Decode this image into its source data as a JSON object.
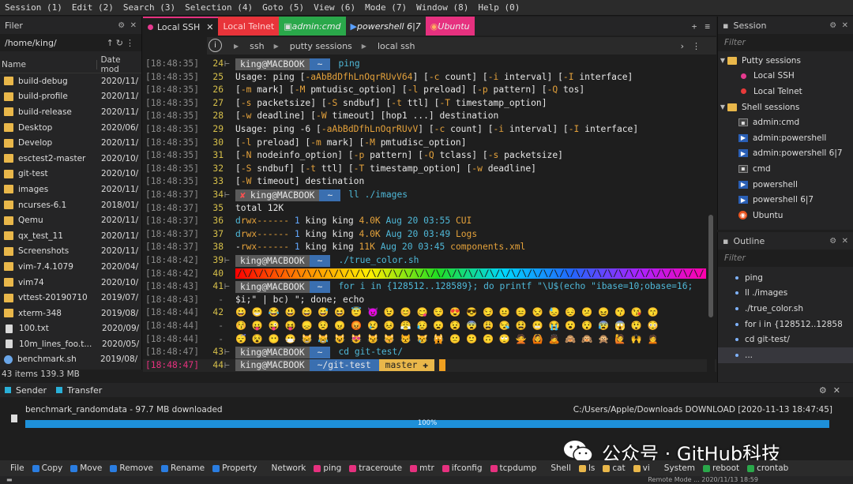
{
  "menu": [
    "Session (1)",
    "Edit (2)",
    "Search (3)",
    "Selection (4)",
    "Goto (5)",
    "View (6)",
    "Mode (7)",
    "Window (8)",
    "Help (0)"
  ],
  "filer": {
    "title": "Filer",
    "path": "/home/king/",
    "col_name": "Name",
    "col_date": "Date mod",
    "items": [
      {
        "name": "build-debug",
        "date": "2020/11/",
        "type": "folder"
      },
      {
        "name": "build-profile",
        "date": "2020/11/",
        "type": "folder"
      },
      {
        "name": "build-release",
        "date": "2020/11/",
        "type": "folder"
      },
      {
        "name": "Desktop",
        "date": "2020/06/",
        "type": "folder"
      },
      {
        "name": "Develop",
        "date": "2020/11/",
        "type": "folder"
      },
      {
        "name": "esctest2-master",
        "date": "2020/10/",
        "type": "folder"
      },
      {
        "name": "git-test",
        "date": "2020/10/",
        "type": "folder"
      },
      {
        "name": "images",
        "date": "2020/11/",
        "type": "folder"
      },
      {
        "name": "ncurses-6.1",
        "date": "2018/01/",
        "type": "folder"
      },
      {
        "name": "Qemu",
        "date": "2020/11/",
        "type": "folder"
      },
      {
        "name": "qx_test_11",
        "date": "2020/11/",
        "type": "folder"
      },
      {
        "name": "Screenshots",
        "date": "2020/11/",
        "type": "folder"
      },
      {
        "name": "vim-7.4.1079",
        "date": "2020/04/",
        "type": "folder"
      },
      {
        "name": "vim74",
        "date": "2020/10/",
        "type": "folder"
      },
      {
        "name": "vttest-20190710",
        "date": "2019/07/",
        "type": "folder"
      },
      {
        "name": "xterm-348",
        "date": "2019/08/",
        "type": "folder"
      },
      {
        "name": "100.txt",
        "date": "2020/09/",
        "type": "file"
      },
      {
        "name": "10m_lines_foo.t...",
        "date": "2020/05/",
        "type": "file"
      },
      {
        "name": "benchmark.sh",
        "date": "2019/08/",
        "type": "sh"
      }
    ],
    "status": "43 items 139.3 MB"
  },
  "tabs": [
    {
      "label": "Local SSH",
      "active": true
    },
    {
      "label": "Local Telnet",
      "color": "#e8343a"
    },
    {
      "label": "admin:cmd",
      "color": "#2aa84a"
    },
    {
      "label": "powershell 6|7",
      "color": "#2a2a2a"
    },
    {
      "label": "Ubuntu",
      "color": "#e6317f"
    }
  ],
  "crumbs": [
    "ssh",
    "putty sessions",
    "local ssh"
  ],
  "term": {
    "lines": [
      {
        "ts": "[18:48:35]",
        "ln": "24",
        "kind": "prompt",
        "user": "king@MACBOOK",
        "dir": "~",
        "cmd": "ping"
      },
      {
        "ts": "[18:48:35]",
        "ln": "25",
        "text": "Usage: ping [-aAbBdDfhLnOqrRUvV64] [-c count] [-i interval] [-I interface]"
      },
      {
        "ts": "[18:48:35]",
        "ln": "26",
        "text": "            [-m mark] [-M pmtudisc_option] [-l preload] [-p pattern] [-Q tos]"
      },
      {
        "ts": "[18:48:35]",
        "ln": "27",
        "text": "            [-s packetsize] [-S sndbuf] [-t ttl] [-T timestamp_option]"
      },
      {
        "ts": "[18:48:35]",
        "ln": "28",
        "text": "            [-w deadline] [-W timeout] [hop1 ...] destination"
      },
      {
        "ts": "[18:48:35]",
        "ln": "29",
        "text": "Usage: ping -6 [-aAbBdDfhLnOqrRUvV] [-c count] [-i interval] [-I interface]"
      },
      {
        "ts": "[18:48:35]",
        "ln": "30",
        "text": "             [-l preload] [-m mark] [-M pmtudisc_option]"
      },
      {
        "ts": "[18:48:35]",
        "ln": "31",
        "text": "             [-N nodeinfo_option] [-p pattern] [-Q tclass] [-s packetsize]"
      },
      {
        "ts": "[18:48:35]",
        "ln": "32",
        "text": "             [-S sndbuf] [-t ttl] [-T timestamp_option] [-w deadline]"
      },
      {
        "ts": "[18:48:35]",
        "ln": "33",
        "text": "             [-W timeout] destination"
      },
      {
        "ts": "[18:48:37]",
        "ln": "34",
        "kind": "prompt",
        "err": "✘",
        "user": "king@MACBOOK",
        "dir": "~",
        "cmd": "ll ./images"
      },
      {
        "ts": "[18:48:37]",
        "ln": "35",
        "text": "total 12K"
      },
      {
        "ts": "[18:48:37]",
        "ln": "36",
        "text": "drwx------ 1 king king 4.0K Aug 20 03:55 CUI"
      },
      {
        "ts": "[18:48:37]",
        "ln": "37",
        "text": "drwx------ 1 king king 4.0K Aug 20 03:49 Logs"
      },
      {
        "ts": "[18:48:37]",
        "ln": "38",
        "text": "-rwx------ 1 king king  11K Aug 20 03:45 components.xml"
      },
      {
        "ts": "[18:48:42]",
        "ln": "39",
        "kind": "prompt",
        "user": "king@MACBOOK",
        "dir": "~",
        "cmd": "./true_color.sh"
      },
      {
        "ts": "[18:48:42]",
        "ln": "40",
        "kind": "rainbow",
        "text": "/\\/\\/\\/\\/\\/\\/\\/\\/\\/\\/\\/\\/\\/\\/\\/\\/\\/\\/\\/\\/\\/\\/\\/\\/\\/\\/\\/\\/\\/\\/\\/\\/\\/\\/\\/\\/\\/\\/\\/\\/\\/\\/\\/"
      },
      {
        "ts": "[18:48:43]",
        "ln": "41",
        "kind": "prompt",
        "user": "king@MACBOOK",
        "dir": "~",
        "cmd": "for i in {128512..128589}; do printf \"\\U$(echo \"ibase=10;obase=16;"
      },
      {
        "ts": "[18:48:43]",
        "ln": "-",
        "text": "$i;\" | bc) \"; done; echo"
      },
      {
        "ts": "[18:48:44]",
        "ln": "42",
        "text": "😀 😁 😂 😃 😄 😅 😆 😇 😈 😉 😊 😋 😌 😍 😎 😏 😐 😑 😒 😓 😔 😕 😖 😗 😘 😙"
      },
      {
        "ts": "[18:48:44]",
        "ln": "-",
        "text": "😚 😛 😜 😝 😞 😟 😠 😡 😢 😣 😤 😥 😦 😧 😨 😩 😪 😫 😬 😭 😮 😯 😰 😱 😲 😳"
      },
      {
        "ts": "[18:48:44]",
        "ln": "-",
        "text": "😴 😵 😶 😷 😸 😹 😺 😻 😼 😽 😾 😿 🙀 🙁 🙂 🙃 🙄 🙅 🙆 🙇 🙈 🙉 🙊 🙋 🙌 🙍"
      },
      {
        "ts": "[18:48:47]",
        "ln": "43",
        "kind": "prompt",
        "user": "king@MACBOOK",
        "dir": "~",
        "cmd": "cd git-test/"
      },
      {
        "ts": "[18:48:47]",
        "ln": "44",
        "kind": "git",
        "user": "king@MACBOOK",
        "dir": "~/git-test",
        "branch": "master ✚",
        "current": true
      }
    ]
  },
  "session": {
    "title": "Session",
    "filter": "Filter",
    "putty_group": "Putty sessions",
    "putty_items": [
      "Local SSH",
      "Local Telnet"
    ],
    "shell_group": "Shell sessions",
    "shell_items": [
      {
        "label": "admin:cmd",
        "icon": "cmd"
      },
      {
        "label": "admin:powershell",
        "icon": "ps"
      },
      {
        "label": "admin:powershell 6|7",
        "icon": "ps"
      },
      {
        "label": "cmd",
        "icon": "cmd"
      },
      {
        "label": "powershell",
        "icon": "ps"
      },
      {
        "label": "powershell 6|7",
        "icon": "ps"
      },
      {
        "label": "Ubuntu",
        "icon": "ub"
      }
    ]
  },
  "outline": {
    "title": "Outline",
    "filter": "Filter",
    "items": [
      "ping",
      "ll ./images",
      "./true_color.sh",
      "for i in {128512..12858",
      "cd git-test/",
      "..."
    ]
  },
  "bottom_tabs": [
    "Sender",
    "Transfer"
  ],
  "transfer": {
    "file": "benchmark_randomdata - 97.7 MB downloaded",
    "dest": "C:/Users/Apple/Downloads DOWNLOAD [2020-11-13 18:47:45]",
    "progress_label": "100%",
    "progress": 1.0
  },
  "toolbar": [
    {
      "label": "File",
      "color": ""
    },
    {
      "label": "Copy",
      "color": "#2a7de1"
    },
    {
      "label": "Move",
      "color": "#2a7de1"
    },
    {
      "label": "Remove",
      "color": "#2a7de1"
    },
    {
      "label": "Rename",
      "color": "#2a7de1"
    },
    {
      "label": "Property",
      "color": "#2a7de1"
    },
    {
      "label": "Network",
      "color": ""
    },
    {
      "label": "ping",
      "color": "#e6317f"
    },
    {
      "label": "traceroute",
      "color": "#e6317f"
    },
    {
      "label": "mtr",
      "color": "#e6317f"
    },
    {
      "label": "ifconfig",
      "color": "#e6317f"
    },
    {
      "label": "tcpdump",
      "color": "#e6317f"
    },
    {
      "label": "Shell",
      "color": ""
    },
    {
      "label": "ls",
      "color": "#e9b74a"
    },
    {
      "label": "cat",
      "color": "#e9b74a"
    },
    {
      "label": "vi",
      "color": "#e9b74a"
    },
    {
      "label": "System",
      "color": ""
    },
    {
      "label": "reboot",
      "color": "#2aa84a"
    },
    {
      "label": "crontab",
      "color": "#2aa84a"
    }
  ],
  "status_right": "Remote Mode  ...  2020/11/13 18:59",
  "watermark": "公众号 · GitHub科技"
}
